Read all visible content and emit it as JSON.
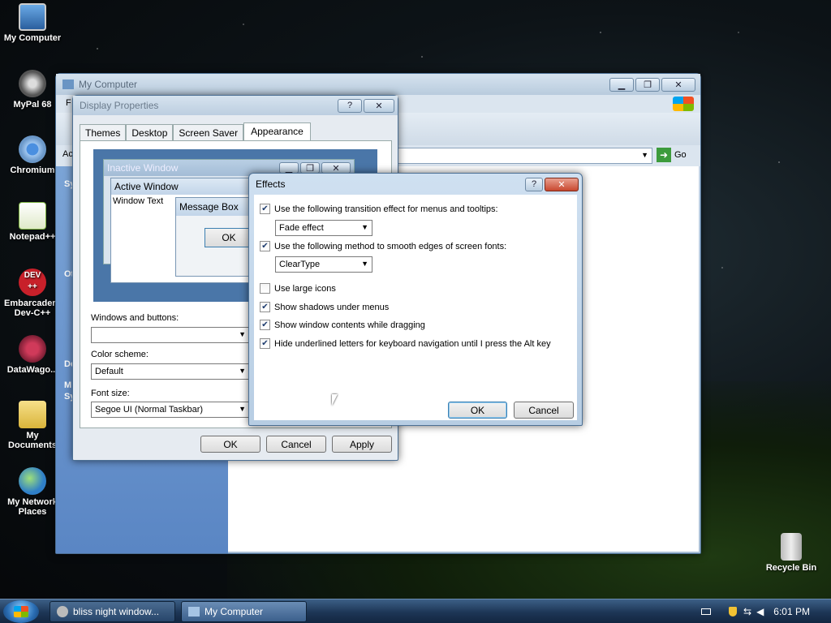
{
  "desktop": {
    "icons": [
      {
        "label": "My Computer"
      },
      {
        "label": "MyPal 68"
      },
      {
        "label": "Chromium"
      },
      {
        "label": "Notepad++"
      },
      {
        "label": "Embarcadero Dev-C++",
        "badge": "DEV ++"
      },
      {
        "label": "DataWago..."
      },
      {
        "label": "My Documents"
      },
      {
        "label": "My Network Places"
      },
      {
        "label": "Recycle Bin"
      }
    ]
  },
  "my_computer": {
    "title": "My Computer",
    "go_label": "Go",
    "sidebar_fragments": [
      "Sy",
      "Ot",
      "De",
      "M",
      "Sy"
    ],
    "menu_fragment": "F",
    "address_fragment": "Ac"
  },
  "display_properties": {
    "title": "Display Properties",
    "tabs": [
      "Themes",
      "Desktop",
      "Screen Saver",
      "Appearance"
    ],
    "preview": {
      "inactive_window": "Inactive Window",
      "active_window": "Active Window",
      "window_text": "Window Text",
      "message_box": "Message Box",
      "ok": "OK"
    },
    "windows_buttons_label": "Windows and buttons:",
    "windows_buttons_value": "",
    "color_scheme_label": "Color scheme:",
    "color_scheme_value": "Default",
    "font_size_label": "Font size:",
    "font_size_value": "Segoe UI (Normal Taskbar)",
    "ok": "OK",
    "cancel": "Cancel",
    "apply": "Apply"
  },
  "effects": {
    "title": "Effects",
    "help": "?",
    "transition_label": "Use the following transition effect for menus and tooltips:",
    "transition_value": "Fade effect",
    "smooth_label": "Use the following method to smooth edges of screen fonts:",
    "smooth_value": "ClearType",
    "large_icons_label": "Use large icons",
    "shadows_label": "Show shadows under menus",
    "drag_label": "Show window contents while dragging",
    "underline_label": "Hide underlined letters for keyboard navigation until I press the Alt key",
    "ok": "OK",
    "cancel": "Cancel"
  },
  "taskbar": {
    "task1": "bliss night window...",
    "task2": "My Computer",
    "time": "6:01 PM"
  },
  "colors": {
    "titlebar_active": "#cfe0f1",
    "titlebar_inactive": "#b7c9db",
    "accent": "#3c7fb1"
  }
}
